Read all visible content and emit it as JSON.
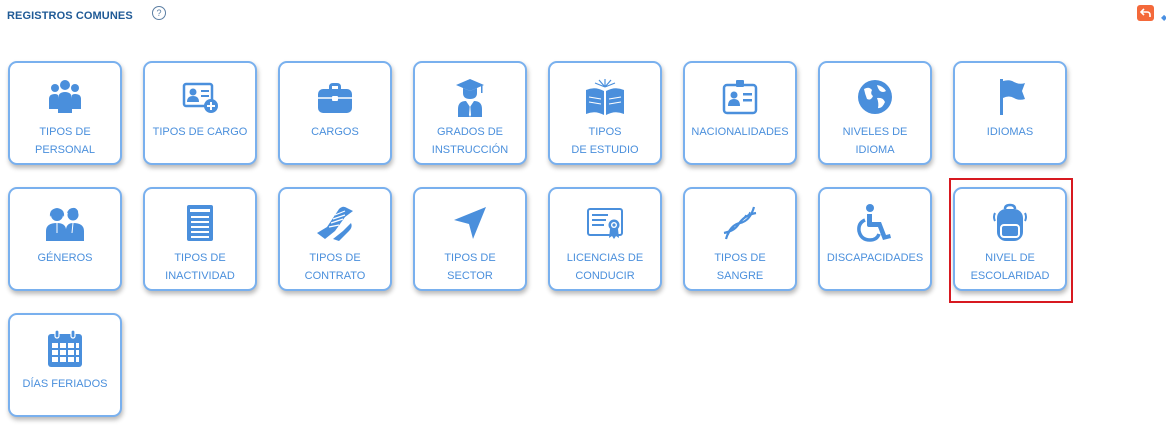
{
  "header": {
    "title": "REGISTROS COMUNES",
    "help_icon": "question-circle-icon",
    "back_icon": "undo-icon",
    "accent": "#f4693a"
  },
  "cards": [
    {
      "label": "TIPOS DE\nPERSONAL",
      "icon": "users-group-icon"
    },
    {
      "label": "TIPOS DE CARGO",
      "icon": "id-card-plus-icon"
    },
    {
      "label": "CARGOS",
      "icon": "briefcase-icon"
    },
    {
      "label": "GRADOS DE\nINSTRUCCIÓN",
      "icon": "graduate-icon"
    },
    {
      "label": "TIPOS\nDE ESTUDIO",
      "icon": "open-book-icon"
    },
    {
      "label": "NACIONALIDADES",
      "icon": "id-badge-icon"
    },
    {
      "label": "NIVELES DE\nIDIOMA",
      "icon": "globe-icon"
    },
    {
      "label": "IDIOMAS",
      "icon": "flag-icon"
    },
    {
      "label": "GÉNEROS",
      "icon": "couple-icon"
    },
    {
      "label": "TIPOS DE\nINACTIVIDAD",
      "icon": "document-list-icon"
    },
    {
      "label": "TIPOS DE\nCONTRATO",
      "icon": "handshake-icon"
    },
    {
      "label": "TIPOS DE\nSECTOR",
      "icon": "location-arrow-icon"
    },
    {
      "label": "LICENCIAS DE\nCONDUCIR",
      "icon": "certificate-icon"
    },
    {
      "label": "TIPOS DE\nSANGRE",
      "icon": "dna-icon"
    },
    {
      "label": "DISCAPACIDADES",
      "icon": "wheelchair-icon"
    },
    {
      "label": "NIVEL DE\nESCOLARIDAD",
      "icon": "backpack-icon"
    },
    {
      "label": "DÍAS FERIADOS",
      "icon": "calendar-icon"
    }
  ],
  "colors": {
    "card_border": "#79b0ee",
    "card_text": "#4a8fdc",
    "icon": "#4a8fdc",
    "highlight": "#d71920",
    "title": "#1f5a96"
  }
}
